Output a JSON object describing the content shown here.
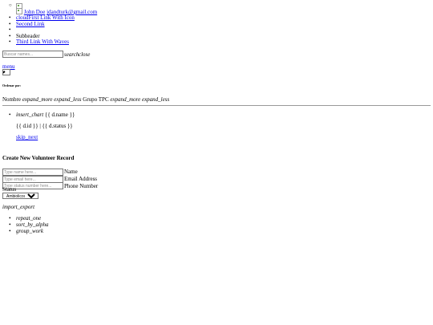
{
  "nav": {
    "user_name": "John Doe",
    "user_email": "jdandturk@gmail.com",
    "link1_icon": "cloud",
    "link1_text": "First Link With Icon",
    "link2": "Second Link",
    "subheader": "Subheader",
    "link3": "Third Link With Waves"
  },
  "search": {
    "placeholder": "Buscar names...",
    "search_icon": "search",
    "close_icon": "close"
  },
  "menu": {
    "label": "menu",
    "select_value": ""
  },
  "sort": {
    "heading": "Ordenar por:",
    "col_nombre": "Nombre",
    "expand_more_1": "expand_more",
    "expand_less_1": "expand_less",
    "col_grupo": "Grupo TPC",
    "expand_more_2": "expand_more",
    "expand_less_2": "expand_less"
  },
  "list": {
    "icon": "insert_chart",
    "name_tpl": "{{ d.name }}",
    "id_status_tpl": "{{ d.id }} | {{ d.status }}",
    "skip_icon": "skip_next"
  },
  "form": {
    "heading": "Create New Volunteer Record",
    "name_placeholder": "Type name here...",
    "name_label": "Name",
    "email_placeholder": "Type email here...",
    "email_label": "Email Address",
    "phone_placeholder": "Type status number here...",
    "phone_label": "Phone Number",
    "status_label": "Status",
    "status_selected": "Ambiolicos",
    "import_icon": "import_export"
  },
  "fab": {
    "item1": "repeat_one",
    "item2": "sort_by_alpha",
    "item3": "group_work"
  }
}
